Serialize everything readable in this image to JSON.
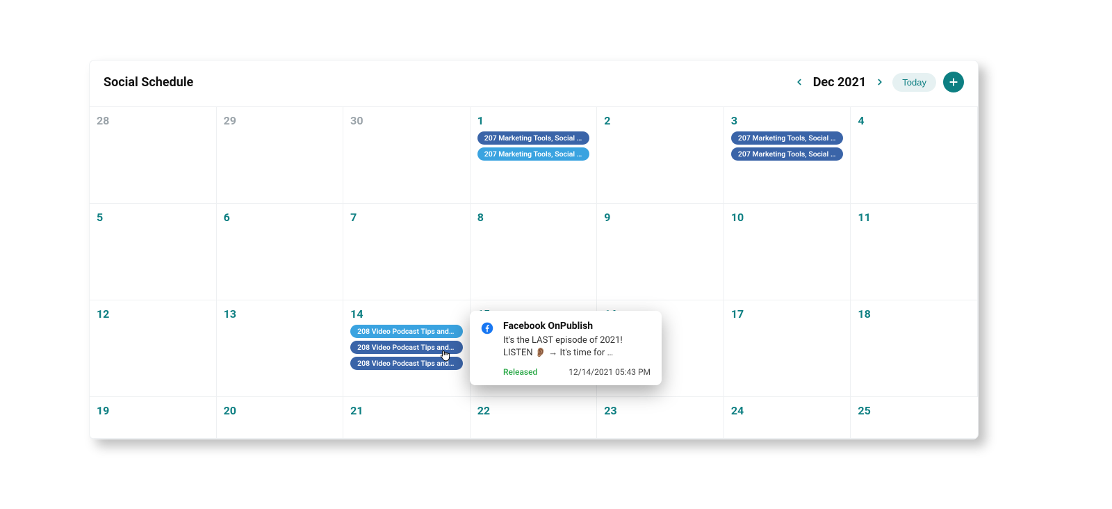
{
  "header": {
    "title": "Social Schedule",
    "month_label": "Dec 2021",
    "today_label": "Today"
  },
  "grid": {
    "cells": [
      {
        "num": "28",
        "muted": true,
        "pills": []
      },
      {
        "num": "29",
        "muted": true,
        "pills": []
      },
      {
        "num": "30",
        "muted": true,
        "pills": []
      },
      {
        "num": "1",
        "muted": false,
        "pills": [
          {
            "label": "207 Marketing Tools, Social …",
            "tone": "dark"
          },
          {
            "label": "207 Marketing Tools, Social …",
            "tone": "light"
          }
        ]
      },
      {
        "num": "2",
        "muted": false,
        "pills": []
      },
      {
        "num": "3",
        "muted": false,
        "pills": [
          {
            "label": "207 Marketing Tools, Social …",
            "tone": "dark"
          },
          {
            "label": "207 Marketing Tools, Social …",
            "tone": "dark"
          }
        ]
      },
      {
        "num": "4",
        "muted": false,
        "pills": []
      },
      {
        "num": "5",
        "muted": false,
        "pills": []
      },
      {
        "num": "6",
        "muted": false,
        "pills": []
      },
      {
        "num": "7",
        "muted": false,
        "pills": []
      },
      {
        "num": "8",
        "muted": false,
        "pills": []
      },
      {
        "num": "9",
        "muted": false,
        "pills": []
      },
      {
        "num": "10",
        "muted": false,
        "pills": []
      },
      {
        "num": "11",
        "muted": false,
        "pills": []
      },
      {
        "num": "12",
        "muted": false,
        "pills": []
      },
      {
        "num": "13",
        "muted": false,
        "pills": []
      },
      {
        "num": "14",
        "muted": false,
        "pills": [
          {
            "label": "208 Video Podcast Tips and…",
            "tone": "light"
          },
          {
            "label": "208 Video Podcast Tips and…",
            "tone": "dark"
          },
          {
            "label": "208 Video Podcast Tips and…",
            "tone": "dark"
          }
        ]
      },
      {
        "num": "15",
        "muted": false,
        "pills": []
      },
      {
        "num": "16",
        "muted": false,
        "pills": []
      },
      {
        "num": "17",
        "muted": false,
        "pills": []
      },
      {
        "num": "18",
        "muted": false,
        "pills": []
      },
      {
        "num": "19",
        "muted": false,
        "pills": []
      },
      {
        "num": "20",
        "muted": false,
        "pills": []
      },
      {
        "num": "21",
        "muted": false,
        "pills": []
      },
      {
        "num": "22",
        "muted": false,
        "pills": []
      },
      {
        "num": "23",
        "muted": false,
        "pills": []
      },
      {
        "num": "24",
        "muted": false,
        "pills": []
      },
      {
        "num": "25",
        "muted": false,
        "pills": []
      }
    ]
  },
  "popover": {
    "title": "Facebook OnPublish",
    "line1": "It's the LAST episode of 2021!",
    "line2": "LISTEN 👂🏽 → It's time for …",
    "status": "Released",
    "timestamp": "12/14/2021 05:43 PM"
  }
}
